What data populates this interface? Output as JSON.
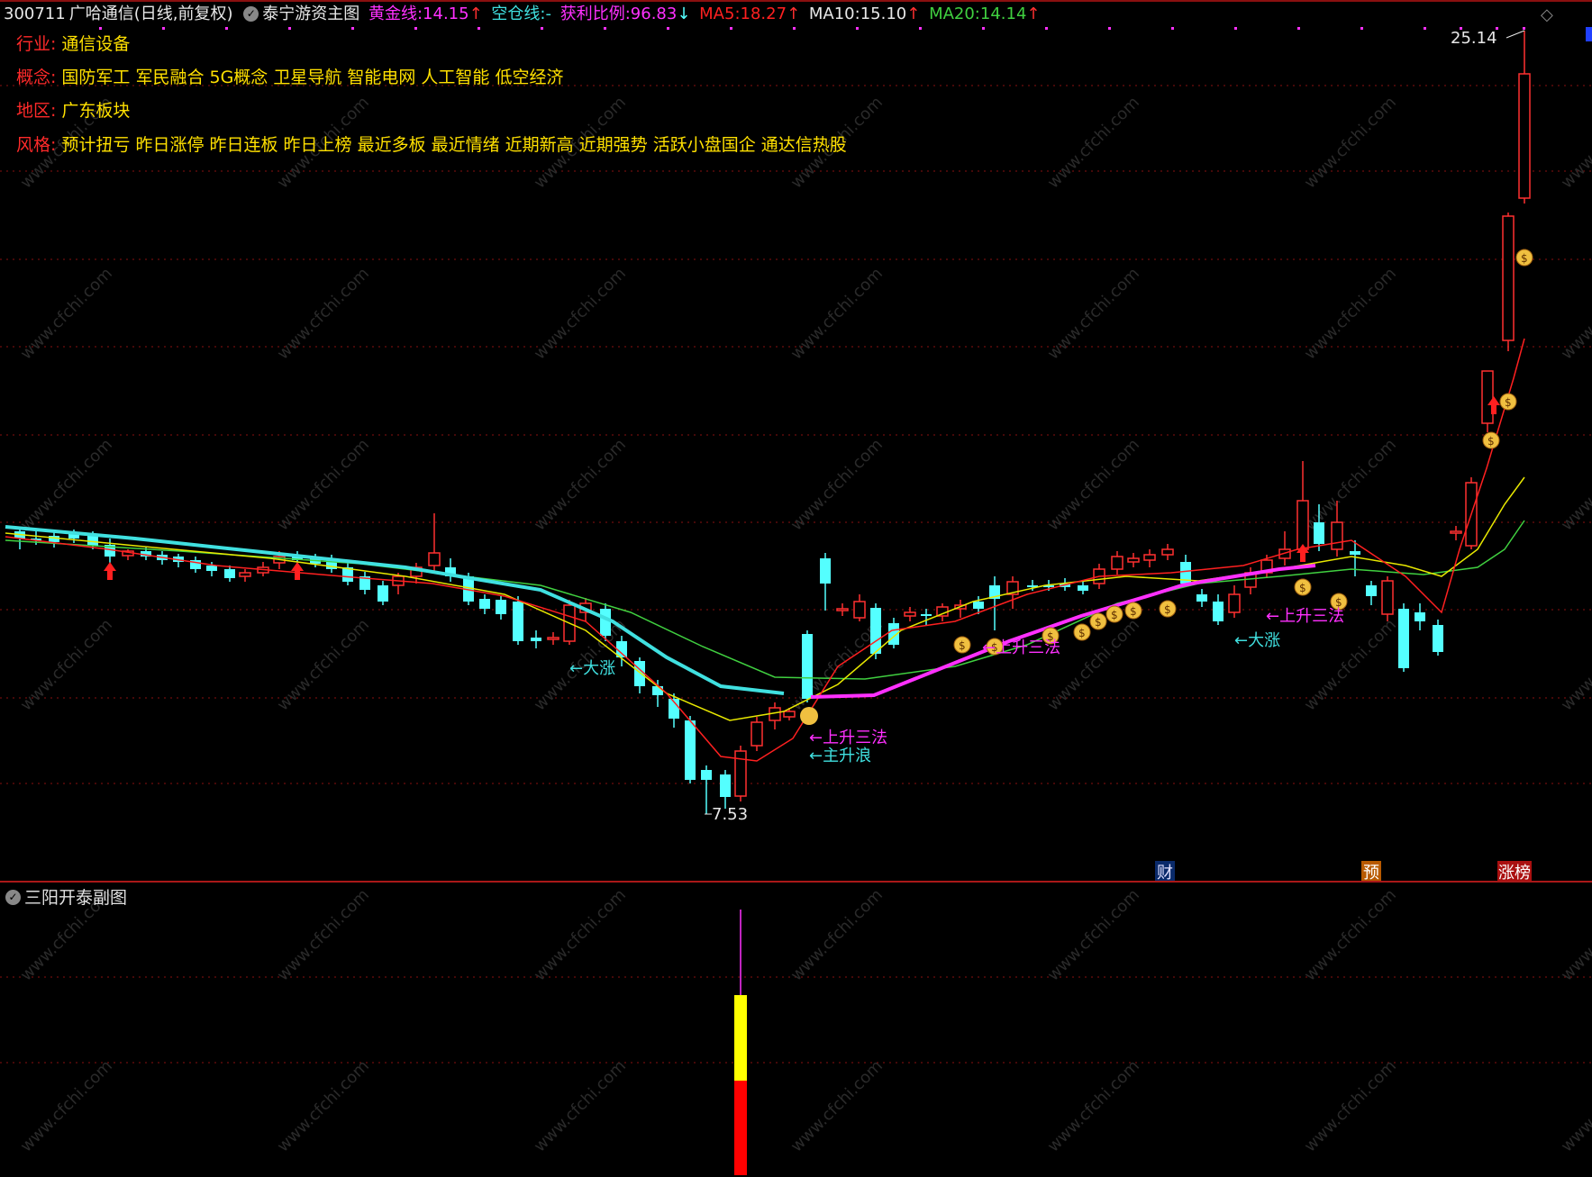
{
  "header": {
    "code": "300711",
    "name": "广哈通信",
    "period": "(日线,前复权)",
    "formula_name": "泰宁游资主图",
    "gold_line_label": "黄金线:",
    "gold_line_value": "14.15",
    "empty_line_label": "空仓线:",
    "empty_line_value": "-",
    "profit_label": "获利比例:",
    "profit_value": "96.83",
    "ma5_label": "MA5:",
    "ma5_value": "18.27",
    "ma10_label": "MA10:",
    "ma10_value": "15.10",
    "ma20_label": "MA20:",
    "ma20_value": "14.14",
    "up_arrow": "↑",
    "down_arrow": "↓",
    "corner_icon": "diamond-icon"
  },
  "info": {
    "industry_label": "行业:",
    "industry_value": "通信设备",
    "concept_label": "概念:",
    "concept_value": "国防军工 军民融合 5G概念 卫星导航 智能电网 人工智能 低空经济",
    "region_label": "地区:",
    "region_value": "广东板块",
    "style_label": "风格:",
    "style_value": "预计扭亏 昨日涨停 昨日连板 昨日上榜 最近多板 最近情绪 近期新高 近期强势 活跃小盘国企 通达信热股"
  },
  "annotations": {
    "high_price": "25.14",
    "low_price": "7.53",
    "big_rise_1": "←大涨",
    "rise_three_1": "←上升三法",
    "main_wave": "←主升浪",
    "rise_three_2": "←上升三法",
    "rise_three_3": "←上升三法",
    "big_rise_2": "←大涨",
    "badge_fin": "财",
    "badge_pre": "预",
    "badge_limit": "涨榜"
  },
  "sub_panel": {
    "title": "三阳开泰副图"
  },
  "colors": {
    "background": "#000000",
    "up_candle": "#ff3030",
    "down_candle": "#54ffff",
    "ma_gold": "#e8e800",
    "ma_red": "#ff2020",
    "ma_green": "#40d040",
    "ma_cyan": "#40e0e0",
    "ma_magenta": "#ff30ff",
    "grid": "#8a1010",
    "text_label": "#ff2a2a",
    "text_value": "#ffe000"
  },
  "watermark": "www.cfchi.com"
}
